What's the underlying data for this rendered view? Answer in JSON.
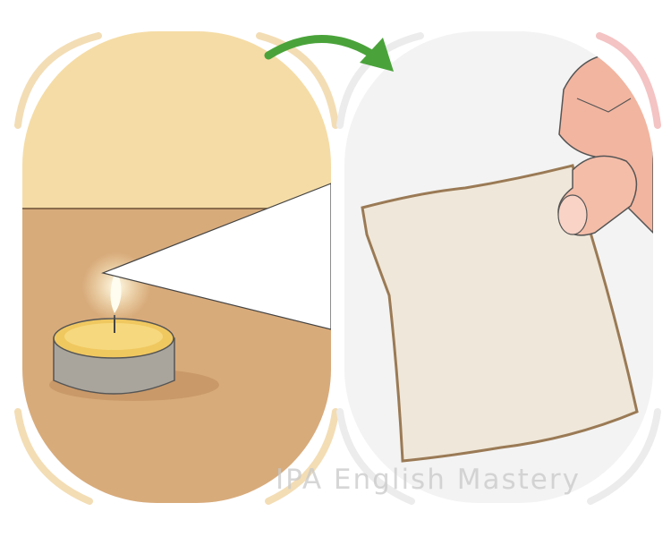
{
  "watermark": "IPA English Mastery",
  "colors": {
    "wall": "#f5dca6",
    "table": "#d8ab7b",
    "right_panel": "#f3f3f3",
    "paper": "#efe7d9",
    "paper_edge": "#9a7a55",
    "arrow": "#4aa33a",
    "candle_wax": "#f0c860",
    "candle_tin": "#a9a59d",
    "skin": "#f2b5a0"
  }
}
